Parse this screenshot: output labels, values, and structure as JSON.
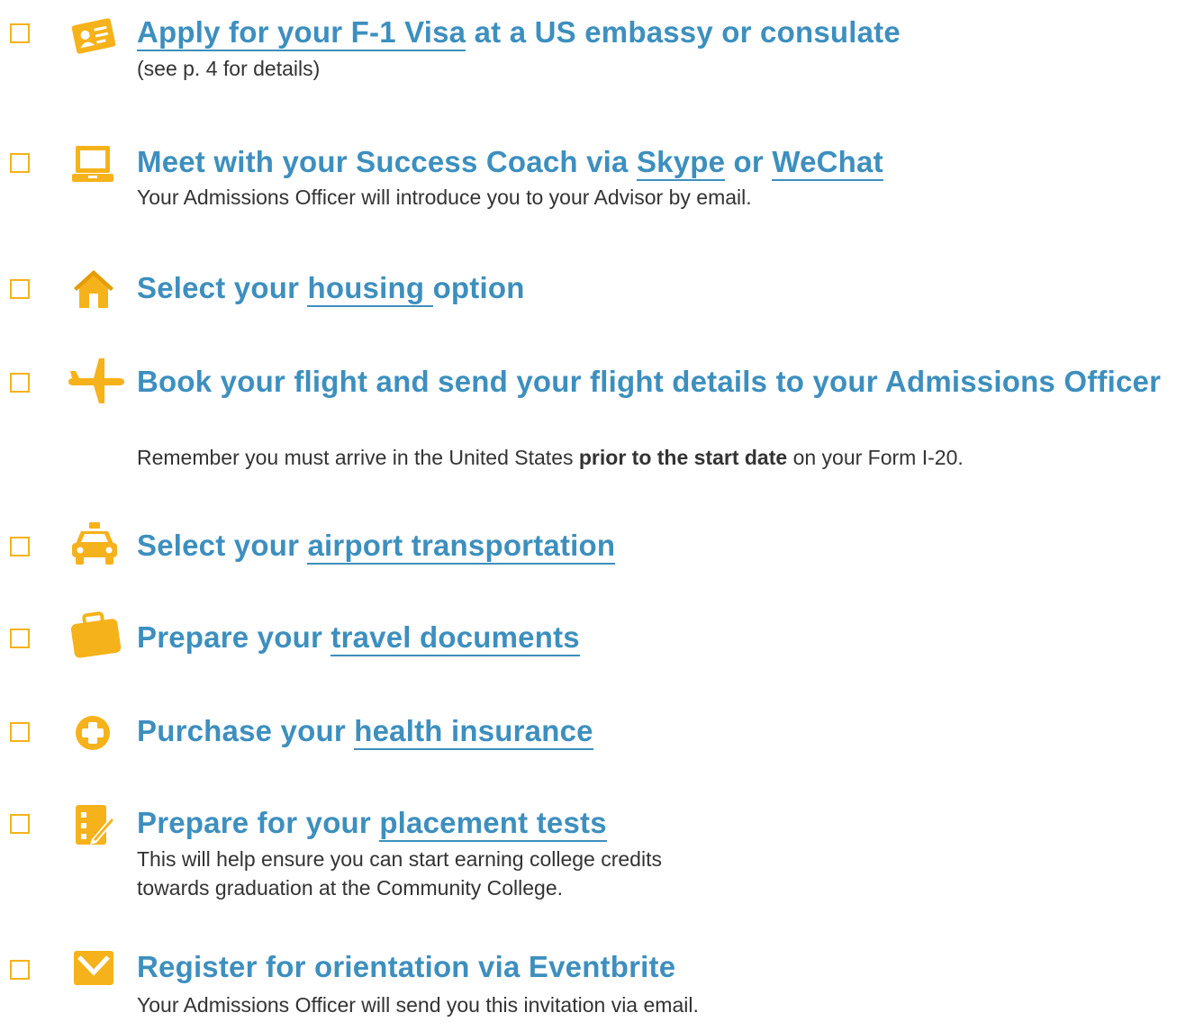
{
  "colors": {
    "accent": "#f6b21a",
    "title": "#3d8fbe",
    "text": "#333333"
  },
  "items": [
    {
      "icon": "id-card-icon",
      "title_link": "Apply for your F-1 Visa",
      "title_rest": " at a US embassy or consulate",
      "desc": "(see p. 4 for details)"
    },
    {
      "icon": "laptop-icon",
      "title_pre": "Meet with your Success Coach via ",
      "link1": "Skype",
      "mid": " or ",
      "link2": "WeChat",
      "desc": "Your Admissions Officer will introduce you to your Advisor by email."
    },
    {
      "icon": "house-icon",
      "title_pre": "Select your ",
      "link": "housing ",
      "title_rest": "option"
    },
    {
      "icon": "airplane-icon",
      "title": "Book your flight and send your flight details to your Admissions Officer",
      "desc_pre": "Remember you must arrive in the United States ",
      "desc_bold": "prior to the start date",
      "desc_post": " on your Form I-20."
    },
    {
      "icon": "taxi-icon",
      "title_pre": "Select your ",
      "link": "airport transportation"
    },
    {
      "icon": "briefcase-icon",
      "title_pre": "Prepare your ",
      "link": "travel documents"
    },
    {
      "icon": "medical-cross-icon",
      "title_pre": "Purchase your ",
      "link": "health insurance"
    },
    {
      "icon": "test-pencil-icon",
      "title_pre": "Prepare for your ",
      "link": "placement tests ",
      "desc_line1": "This will help ensure you can start earning college credits",
      "desc_line2": "towards graduation at the Community College."
    },
    {
      "icon": "envelope-icon",
      "title": "Register for orientation via Eventbrite",
      "desc": "Your Admissions Officer will send you this invitation via email."
    }
  ]
}
